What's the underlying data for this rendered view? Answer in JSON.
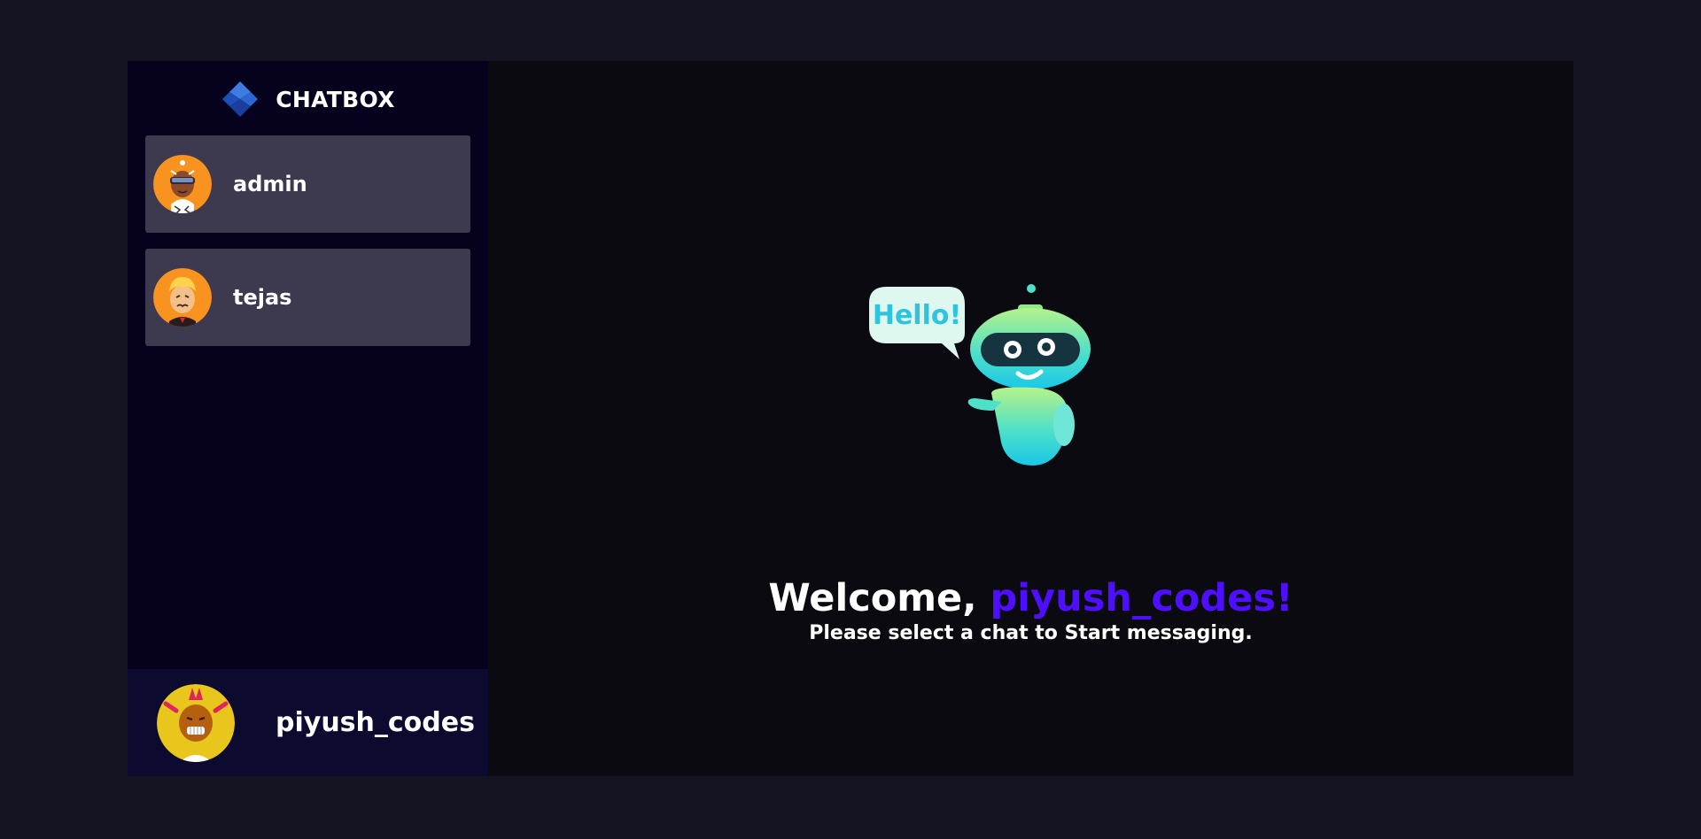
{
  "brand": {
    "name": "CHATBOX"
  },
  "contacts": [
    {
      "name": "admin"
    },
    {
      "name": "tejas"
    }
  ],
  "current_user": {
    "name": "piyush_codes"
  },
  "welcome": {
    "greeting": "Welcome,",
    "username": "piyush_codes!",
    "subtitle": "Please select a chat to Start messaging."
  },
  "robot": {
    "speech": "Hello!"
  },
  "colors": {
    "page_bg": "#141423",
    "sidebar_bg": "#06021e",
    "contact_bg": "#3d3a4f",
    "current_user_bg": "#0c0a2e",
    "main_bg": "#0b0a10",
    "accent": "#4e0eff"
  }
}
